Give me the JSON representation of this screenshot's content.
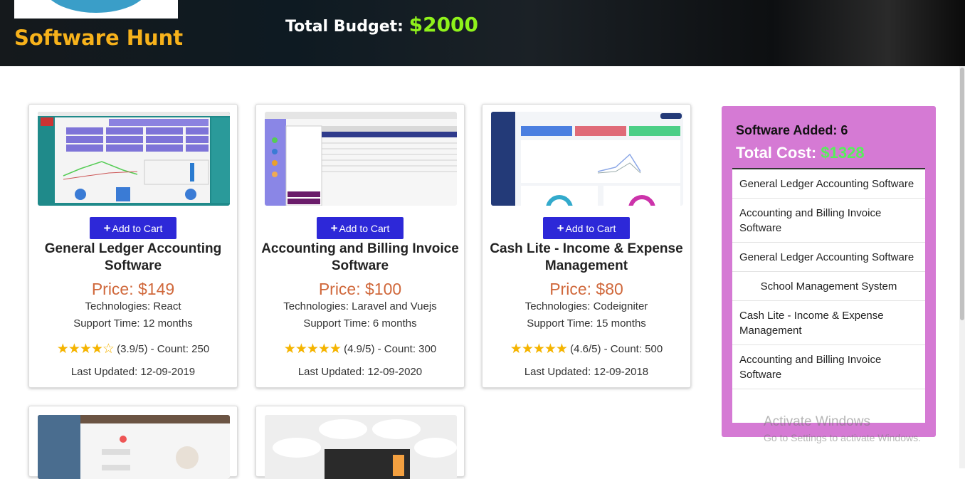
{
  "header": {
    "brand": "Software Hunt",
    "budget_label": "Total Budget:",
    "budget_value": "$2000"
  },
  "products": [
    {
      "add_label": "Add to Cart",
      "title": "General Ledger Accounting Software",
      "price": "Price: $149",
      "tech": "Technologies: React",
      "support": "Support Time: 12 months",
      "stars": "★★★★☆",
      "rating": "(3.9/5) - Count: 250",
      "updated": "Last Updated: 12-09-2019"
    },
    {
      "add_label": "Add to Cart",
      "title": "Accounting and Billing Invoice Software",
      "price": "Price: $100",
      "tech": "Technologies: Laravel and Vuejs",
      "support": "Support Time: 6 months",
      "stars": "★★★★★",
      "rating": "(4.9/5) - Count: 300",
      "updated": "Last Updated: 12-09-2020"
    },
    {
      "add_label": "Add to Cart",
      "title": "Cash Lite - Income & Expense Management",
      "price": "Price: $80",
      "tech": "Technologies: Codeigniter",
      "support": "Support Time: 15 months",
      "stars": "★★★★★",
      "rating": "(4.6/5) - Count: 500",
      "updated": "Last Updated: 12-09-2018"
    }
  ],
  "cart": {
    "added_text": "Software Added: 6",
    "total_label": "Total Cost:",
    "total_value": "$1328",
    "items": [
      "General Ledger Accounting Software",
      "Accounting and Billing Invoice Software",
      "General Ledger Accounting Software",
      "School Management System",
      "Cash Lite - Income & Expense Management",
      "Accounting and Billing Invoice Software"
    ]
  },
  "watermark": {
    "line1": "Activate Windows",
    "line2": "Go to Settings to activate Windows."
  },
  "colors": {
    "brand": "#f7b21b",
    "budget_value": "#8ff21b",
    "button": "#2d28d8",
    "price": "#d0683b",
    "star": "#f5b400",
    "cart_bg": "#d57ad4",
    "cart_total": "#56f05a"
  }
}
